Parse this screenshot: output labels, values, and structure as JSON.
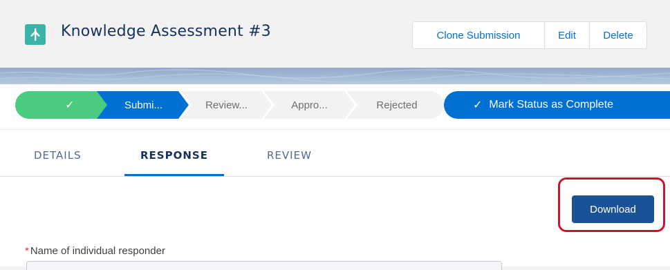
{
  "header": {
    "app_icon": "knowledge-app-icon",
    "title": "Knowledge Assessment #3",
    "actions": [
      "Clone Submission",
      "Edit",
      "Delete"
    ],
    "icon_color": "#3bb3a9"
  },
  "path": {
    "stages": [
      {
        "label": "",
        "icon": "checkmark-icon",
        "state": "complete"
      },
      {
        "label": "Submi...",
        "state": "current"
      },
      {
        "label": "Review...",
        "state": "incomplete"
      },
      {
        "label": "Appro...",
        "state": "incomplete"
      },
      {
        "label": "Rejected",
        "state": "incomplete"
      }
    ],
    "mark_complete_label": "Mark Status as Complete",
    "colors": {
      "complete": "#4bca81",
      "current": "#0070d2",
      "incomplete": "#f3f2f2"
    }
  },
  "tabs": {
    "items": [
      "DETAILS",
      "RESPONSE",
      "REVIEW"
    ],
    "active": "RESPONSE"
  },
  "response": {
    "download_label": "Download",
    "field_required_marker": "*",
    "field_label": "Name of individual responder",
    "field_value": ""
  }
}
